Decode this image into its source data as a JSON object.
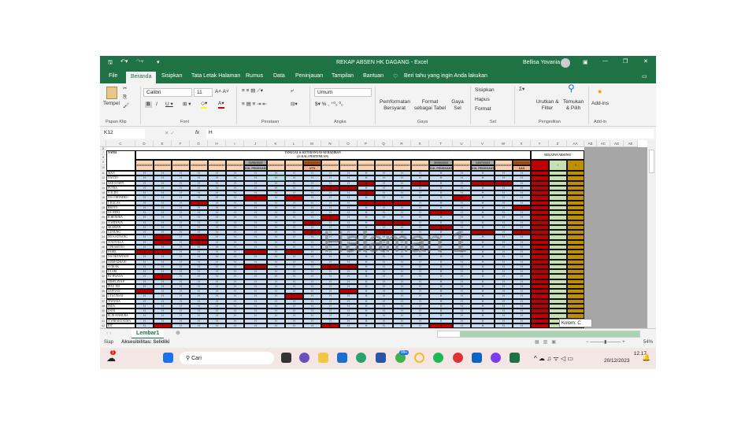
{
  "window": {
    "title": "REKAP ABSEN HK DAGANG  -  Excel",
    "user": "Bellisa Yovania"
  },
  "tabs": [
    "File",
    "Beranda",
    "Sisipkan",
    "Tata Letak Halaman",
    "Rumus",
    "Data",
    "Peninjauan",
    "Tampilan",
    "Bantuan"
  ],
  "tellme": "Beri tahu yang ingin Anda lakukan",
  "ribbon": {
    "paste": "Tempel",
    "font_name": "Calibri",
    "font_size": "11",
    "number_format": "Umum",
    "cond_format": "Pemformatan Bersyarat",
    "format_table": "Format sebagai Tabel",
    "cell_style": "Gaya Sel",
    "insert": "Sisipkan",
    "delete": "Hapus",
    "format": "Format",
    "sort": "Urutkan & Filter",
    "find": "Temukan & Pilih",
    "addins": "Add-ins",
    "groups": {
      "clipboard": "Papan Klip",
      "font": "Font",
      "align": "Perataan",
      "number": "Angka",
      "styles": "Gaya",
      "cells": "Sel",
      "editing": "Pengeditan",
      "addin": "Add-in"
    }
  },
  "formula": {
    "name_box": "K12",
    "fx": "fx",
    "value": "H"
  },
  "sheet": {
    "columns": [
      "C",
      "D",
      "E",
      "F",
      "G",
      "H",
      "I",
      "J",
      "K",
      "L",
      "M",
      "N",
      "O",
      "P",
      "Q",
      "R",
      "S",
      "T",
      "U",
      "V",
      "W",
      "X",
      "Y",
      "Z",
      "AA",
      "AB",
      "AC",
      "AD",
      "AE"
    ],
    "name_header": "NAMA",
    "title1": "TANGGAL & KETERANGAN KEHADIRAN",
    "title2": "(21 KALI PERTEMUAN)",
    "recap_title": "REKAPAN ABSENSI",
    "recap_headers": [
      "A",
      "I",
      "S"
    ],
    "date_default": "##########",
    "special_dates": [
      {
        "col": 6,
        "top": "21/06/2023",
        "bottom": "KUL PENGGANTI"
      },
      {
        "col": 9,
        "top": "##########",
        "bottom": "UTS"
      },
      {
        "col": 16,
        "top": "30/06/2023",
        "bottom": "KUL PENGGANTI"
      },
      {
        "col": 18,
        "top": "14/07/2023",
        "bottom": "KUL PENGGANTI"
      },
      {
        "col": 20,
        "top": "##########",
        "bottom": "UAS"
      }
    ],
    "present": "H",
    "absent": "A",
    "rows": [
      {
        "no": "11",
        "name": "MAN",
        "absent": []
      },
      {
        "no": "12",
        "name": "NANTO",
        "absent": []
      },
      {
        "no": "13",
        "name": "SAD SYAFI'I",
        "absent": [
          12,
          15,
          18,
          19
        ]
      },
      {
        "no": "14",
        "name": "PUTRA",
        "absent": [
          10,
          11
        ]
      },
      {
        "no": "15",
        "name": "S ALDO",
        "absent": [
          12
        ]
      },
      {
        "no": "16",
        "name": "DA CORTADEO",
        "absent": [
          6,
          8,
          17
        ]
      },
      {
        "no": "17",
        "name": "L BAGAS",
        "absent": [
          3,
          12,
          13,
          14
        ]
      },
      {
        "no": "18",
        "name": "BROTO",
        "absent": [
          20
        ]
      },
      {
        "no": "19",
        "name": "US WERI",
        "absent": [
          16
        ]
      },
      {
        "no": "20",
        "name": "H HENDRA",
        "absent": [
          10
        ]
      },
      {
        "no": "21",
        "name": "A WIDJAJA",
        "absent": [
          9,
          13,
          14
        ]
      },
      {
        "no": "22",
        "name": "SKARIAN",
        "absent": [
          16
        ]
      },
      {
        "no": "23",
        "name": "GUNUNG",
        "absent": [
          9,
          13,
          18,
          20
        ]
      },
      {
        "no": "24",
        "name": "DO KAUNANG",
        "absent": [
          1,
          3
        ]
      },
      {
        "no": "25",
        "name": "A NOVILLA",
        "absent": [
          1,
          3
        ]
      },
      {
        "no": "26",
        "name": "T PRASETIO",
        "absent": []
      },
      {
        "no": "27",
        "name": "FAREL",
        "absent": [
          0,
          1,
          6,
          8
        ]
      },
      {
        "no": "28",
        "name": "NA OKTAVIANI",
        "absent": []
      },
      {
        "no": "29",
        "name": "I IRMADHANI",
        "absent": []
      },
      {
        "no": "30",
        "name": "A OKAK",
        "absent": [
          6,
          10,
          11
        ]
      },
      {
        "no": "31",
        "name": "ULARI",
        "absent": []
      },
      {
        "no": "32",
        "name": "RY BWANA",
        "absent": [
          1
        ]
      },
      {
        "no": "33",
        "name": "ARSELINA P",
        "absent": []
      },
      {
        "no": "34",
        "name": "IPAU TRI",
        "absent": []
      },
      {
        "no": "35",
        "name": "SAPTIAN",
        "absent": [
          0,
          11
        ]
      },
      {
        "no": "36",
        "name": "UTA UNSAI",
        "absent": [
          8
        ]
      },
      {
        "no": "37",
        "name": "TIWANIA",
        "absent": []
      },
      {
        "no": "38",
        "name": "INDA",
        "absent": []
      },
      {
        "no": "39",
        "name": "DANI",
        "absent": []
      },
      {
        "no": "40",
        "name": "ELIN MAHURA",
        "absent": []
      },
      {
        "no": "41",
        "name": "A WIRAKUSUMA",
        "absent": []
      },
      {
        "no": "42",
        "name": "RIT",
        "absent": [
          1,
          10,
          16
        ]
      }
    ],
    "watermark": "Halaman 1",
    "tooltip": "Kolom: C",
    "sheet_tab": "Lembar1"
  },
  "status": {
    "ready": "Siap",
    "accessibility": "Aksesibilitas: Selidiki",
    "zoom": "54%"
  },
  "taskbar": {
    "search": "Cari",
    "whatsapp_badge": "99+",
    "weather_badge": "1",
    "time": "12.17",
    "date": "20/12/2023"
  },
  "colors": {
    "excel_green": "#1f7244",
    "present": "#c5d9f1",
    "absent": "#c00000",
    "header": "#fbd4b4",
    "sick": "#bf8f00",
    "permit": "#c6e0b4"
  }
}
